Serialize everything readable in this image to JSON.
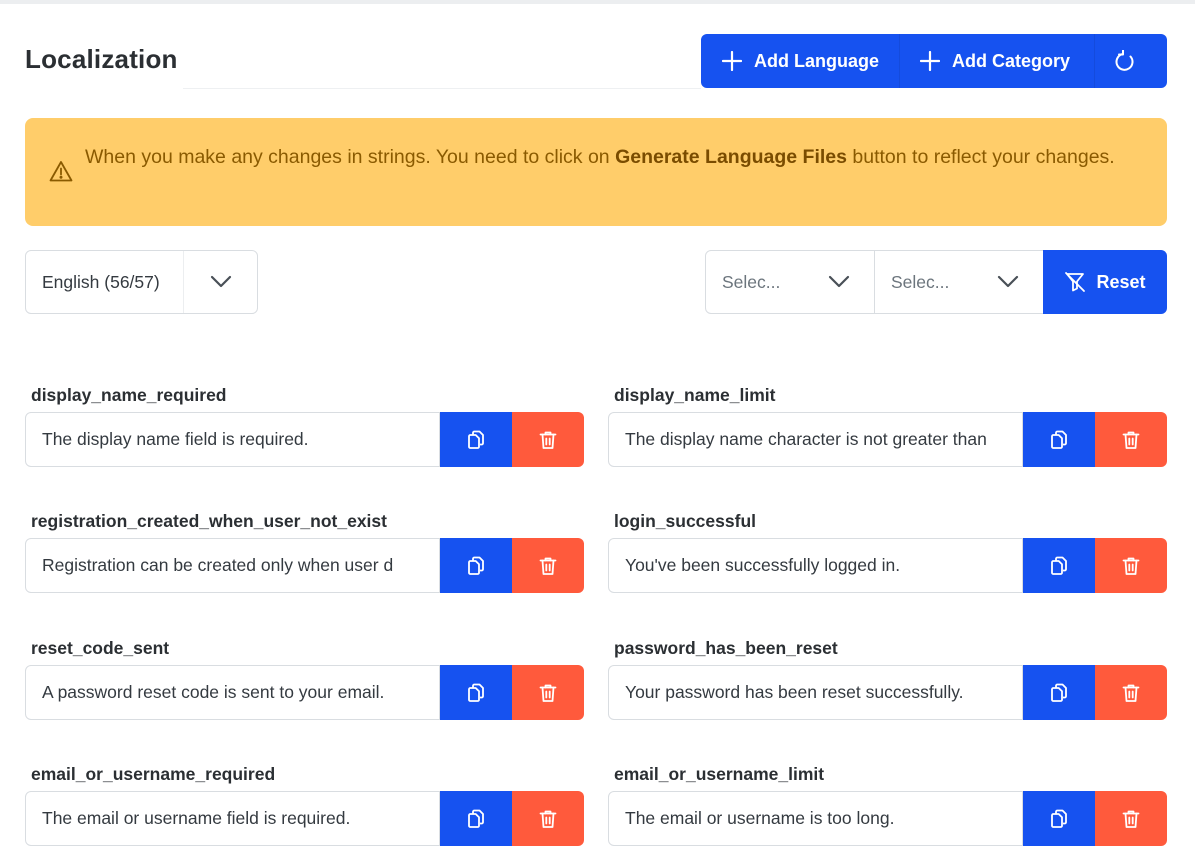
{
  "header": {
    "title": "Localization",
    "add_language_label": "Add Language",
    "add_category_label": "Add Category"
  },
  "alert": {
    "text_before": "When you make any changes in strings. You need to click on ",
    "bold_text": "Generate Language Files",
    "text_after": " button to reflect your changes."
  },
  "filters": {
    "language_value": "English (56/57)",
    "filter1_placeholder": "Selec...",
    "filter2_placeholder": "Selec...",
    "reset_label": "Reset"
  },
  "colors": {
    "primary": "#1652f0",
    "danger": "#ff5a3c",
    "warning_bg": "#ffcd6a",
    "warning_text": "#8a5a00"
  },
  "icons": {
    "add": "plus-icon",
    "refresh": "refresh-icon",
    "alert": "warning-triangle-icon",
    "select": "chevron-down-icon",
    "reset": "filter-off-icon",
    "copy": "copy-icon",
    "delete": "trash-icon"
  },
  "strings": [
    {
      "key": "display_name_required",
      "value": "The display name field is required."
    },
    {
      "key": "display_name_limit",
      "value": "The display name character is not greater than"
    },
    {
      "key": "registration_created_when_user_not_exist",
      "value": "Registration can be created only when user d"
    },
    {
      "key": "login_successful",
      "value": "You've been successfully logged in."
    },
    {
      "key": "reset_code_sent",
      "value": "A password reset code is sent to your email."
    },
    {
      "key": "password_has_been_reset",
      "value": "Your password has been reset successfully."
    },
    {
      "key": "email_or_username_required",
      "value": "The email or username field is required."
    },
    {
      "key": "email_or_username_limit",
      "value": "The email or username is too long."
    }
  ]
}
